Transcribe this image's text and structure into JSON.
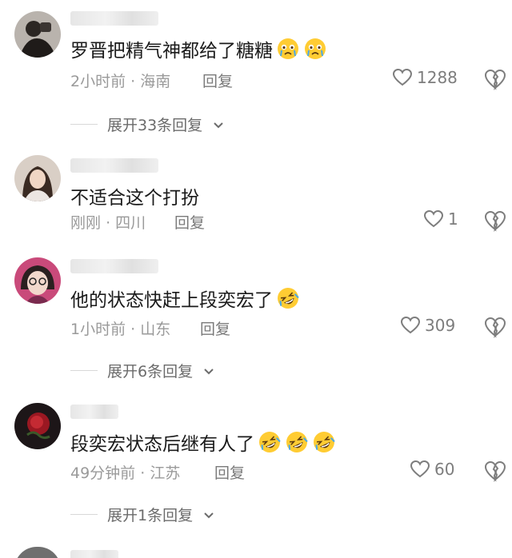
{
  "comments": [
    {
      "text": "罗晋把精气神都给了糖糖",
      "emojis": [
        "crying-face",
        "crying-face"
      ],
      "time": "2小时前",
      "sep": "·",
      "location": "海南",
      "reply_label": "回复",
      "likes": "1288",
      "expand_label": "展开33条回复"
    },
    {
      "text": "不适合这个打扮",
      "emojis": [],
      "time": "刚刚",
      "sep": "·",
      "location": "四川",
      "reply_label": "回复",
      "likes": "1"
    },
    {
      "text": "他的状态快赶上段奕宏了",
      "emojis": [
        "rolling-laughing-face"
      ],
      "time": "1小时前",
      "sep": "·",
      "location": "山东",
      "reply_label": "回复",
      "likes": "309",
      "expand_label": "展开6条回复"
    },
    {
      "text": "段奕宏状态后继有人了",
      "emojis": [
        "rolling-laughing-face",
        "rolling-laughing-face",
        "rolling-laughing-face"
      ],
      "time": "49分钟前",
      "sep": "·",
      "location": "江苏",
      "reply_label": "回复",
      "likes": "60",
      "expand_label": "展开1条回复"
    }
  ],
  "colors": {
    "meta": "#9a9a9a",
    "text": "#1b1b1b",
    "emoji_yellow": "#ffcc33"
  }
}
